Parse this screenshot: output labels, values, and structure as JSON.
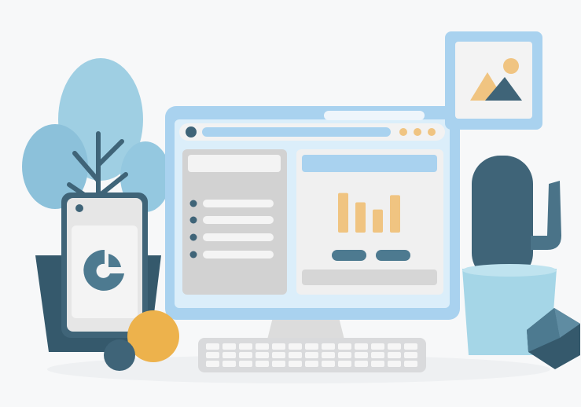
{
  "scene": {
    "description_items": [
      "monitor-with-dashboard",
      "plant",
      "phone-with-chart-logo",
      "cactus-in-pot",
      "photo-frame",
      "keyboard",
      "balls",
      "geometric-gem"
    ],
    "colors": {
      "background": "#f7f8f9",
      "screen_frame": "#a9d2ef",
      "screen_inner": "#dff0fb",
      "panel_gray": "#d7d7d7",
      "panel_light": "#f1f1f1",
      "accent_bar": "#f0c481",
      "dark_teal": "#3f6478",
      "light_blue": "#8fc4df",
      "yellow_ball": "#edb24c"
    },
    "chart_bars": [
      0.72,
      0.55,
      0.42,
      0.68
    ],
    "list_rows": 4
  }
}
